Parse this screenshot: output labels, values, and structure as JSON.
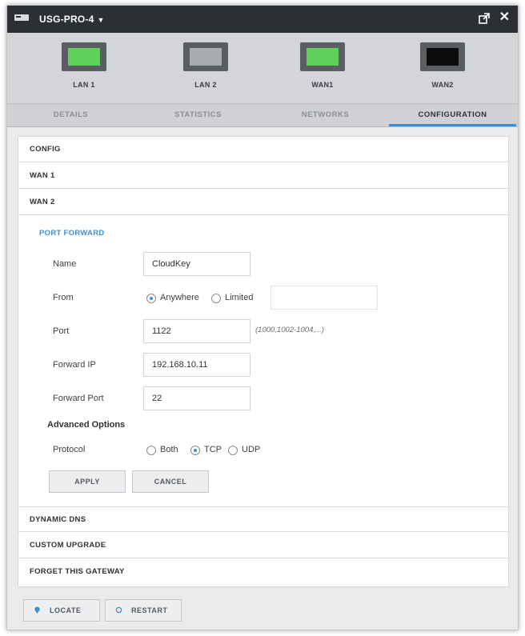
{
  "window": {
    "title": "USG-PRO-4",
    "title_caret": "▼",
    "close_glyph": "✕",
    "popout_icon": "popout-icon"
  },
  "ports": [
    {
      "label": "LAN 1",
      "status_color": "#5fd15a"
    },
    {
      "label": "LAN 2",
      "status_color": "#a9acaf"
    },
    {
      "label": "WAN1",
      "status_color": "#5fd15a"
    },
    {
      "label": "WAN2",
      "status_color": "#0d0d0d"
    }
  ],
  "tabs": [
    {
      "label": "DETAILS"
    },
    {
      "label": "STATISTICS"
    },
    {
      "label": "NETWORKS"
    },
    {
      "label": "CONFIGURATION",
      "active": true
    }
  ],
  "sections_top": [
    "CONFIG",
    "WAN 1",
    "WAN 2"
  ],
  "port_forward": {
    "title": "PORT FORWARD",
    "name_label": "Name",
    "name_value": "CloudKey",
    "from_label": "From",
    "from_options": [
      "Anywhere",
      "Limited"
    ],
    "from_selected": "Anywhere",
    "port_label": "Port",
    "port_value": "1122",
    "port_hint": "(1000,1002-1004,...)",
    "forward_ip_label": "Forward IP",
    "forward_ip_value": "192.168.10.11",
    "forward_port_label": "Forward Port",
    "forward_port_value": "22",
    "advanced_label": "Advanced Options",
    "protocol_label": "Protocol",
    "protocol_options": [
      "Both",
      "TCP",
      "UDP"
    ],
    "protocol_selected": "TCP",
    "apply_label": "APPLY",
    "cancel_label": "CANCEL"
  },
  "sections_bottom": [
    "DYNAMIC DNS",
    "CUSTOM UPGRADE",
    "FORGET THIS GATEWAY"
  ],
  "footer": {
    "locate_label": "LOCATE",
    "restart_label": "RESTART"
  },
  "colors": {
    "accent": "#3d8fd1",
    "titlebar": "#2c2f33"
  }
}
